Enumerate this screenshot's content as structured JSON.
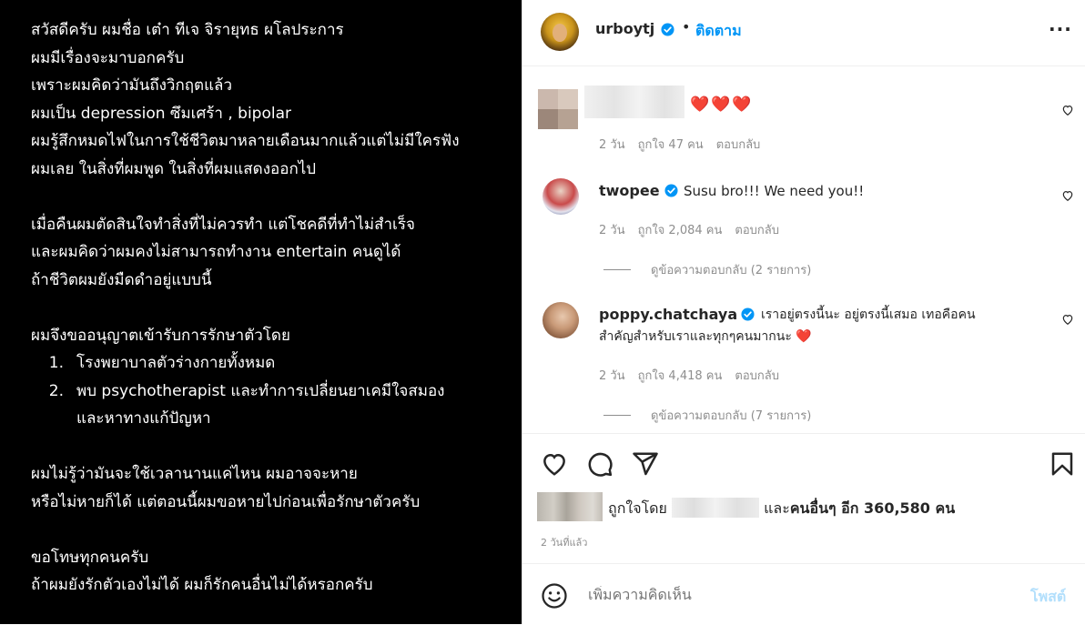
{
  "post_image": {
    "lines": [
      "สวัสดีครับ ผมชื่อ เต๋า ทีเจ จิรายุทธ ผโลประการ",
      "ผมมีเรื่องจะมาบอกครับ",
      "เพราะผมคิดว่ามันถึงวิกฤตแล้ว",
      "ผมเป็น depression ซึมเศร้า , bipolar",
      "ผมรู้สึกหมดไฟในการใช้ชีวิตมาหลายเดือนมากแล้วแต่ไม่มีใครฟัง",
      "ผมเลย ในสิ่งที่ผมพูด ในสิ่งที่ผมแสดงออกไป",
      "",
      "เมื่อคืนผมตัดสินใจทำสิ่งที่ไม่ควรทำ แต่โชคดีที่ทำไม่สำเร็จ",
      "และผมคิดว่าผมคงไม่สามารถทำงาน entertain คนดูได้",
      "ถ้าชีวิตผมยังมืดดำอยู่แบบนี้",
      "",
      "ผมจึงขออนุญาตเข้ารับการรักษาตัวโดย"
    ],
    "list": [
      {
        "num": "1.",
        "text": "โรงพยาบาลตัวร่างกายทั้งหมด"
      },
      {
        "num": "2.",
        "text": "พบ psychotherapist และทำการเปลี่ยนยาเคมีใจสมอง"
      }
    ],
    "list_continuation": "และหาทางแก้ปัญหา",
    "lines_after": [
      "",
      "ผมไม่รู้ว่ามันจะใช้เวลานานแค่ไหน ผมอาจจะหาย",
      "หรือไม่หายก็ได้ แต่ตอนนี้ผมขอหายไปก่อนเพื่อรักษาตัวครับ",
      "",
      "ขอโทษทุกคนครับ",
      "ถ้าผมยังรักตัวเองไม่ได้ ผมก็รักคนอื่นไม่ได้หรอกครับ"
    ]
  },
  "header": {
    "username": "urboytj",
    "separator": "•",
    "follow_label": "ติดตาม",
    "more_label": "···"
  },
  "comments": [
    {
      "text": "❤️❤️❤️",
      "time": "2 วัน",
      "likes": "ถูกใจ 47 คน",
      "reply_label": "ตอบกลับ"
    },
    {
      "username": "twopee",
      "text": "Susu bro!!! We need you!!",
      "time": "2 วัน",
      "likes": "ถูกใจ 2,084 คน",
      "reply_label": "ตอบกลับ",
      "view_replies": "ดูข้อความตอบกลับ (2 รายการ)"
    },
    {
      "username": "poppy.chatchaya",
      "text_line1": "เราอยู่ตรงนี้นะ อยู่ตรงนี้เสมอ เทอคือคน",
      "text_line2": "สำคัญสำหรับเราและทุกๆคนมากนะ ❤️",
      "time": "2 วัน",
      "likes": "ถูกใจ 4,418 คน",
      "reply_label": "ตอบกลับ",
      "view_replies": "ดูข้อความตอบกลับ (7 รายการ)"
    }
  ],
  "likes": {
    "prefix": "ถูกใจโดย",
    "suffix_and": "และ",
    "suffix_bold": "คนอื่นๆ อีก 360,580 คน"
  },
  "timestamp": "2 วันที่แล้ว",
  "composer": {
    "placeholder": "เพิ่มความคิดเห็น",
    "post_label": "โพสต์"
  },
  "colors": {
    "accent": "#0095f6",
    "heart_red": "#ed4956",
    "post_disabled": "#b2dffc"
  }
}
